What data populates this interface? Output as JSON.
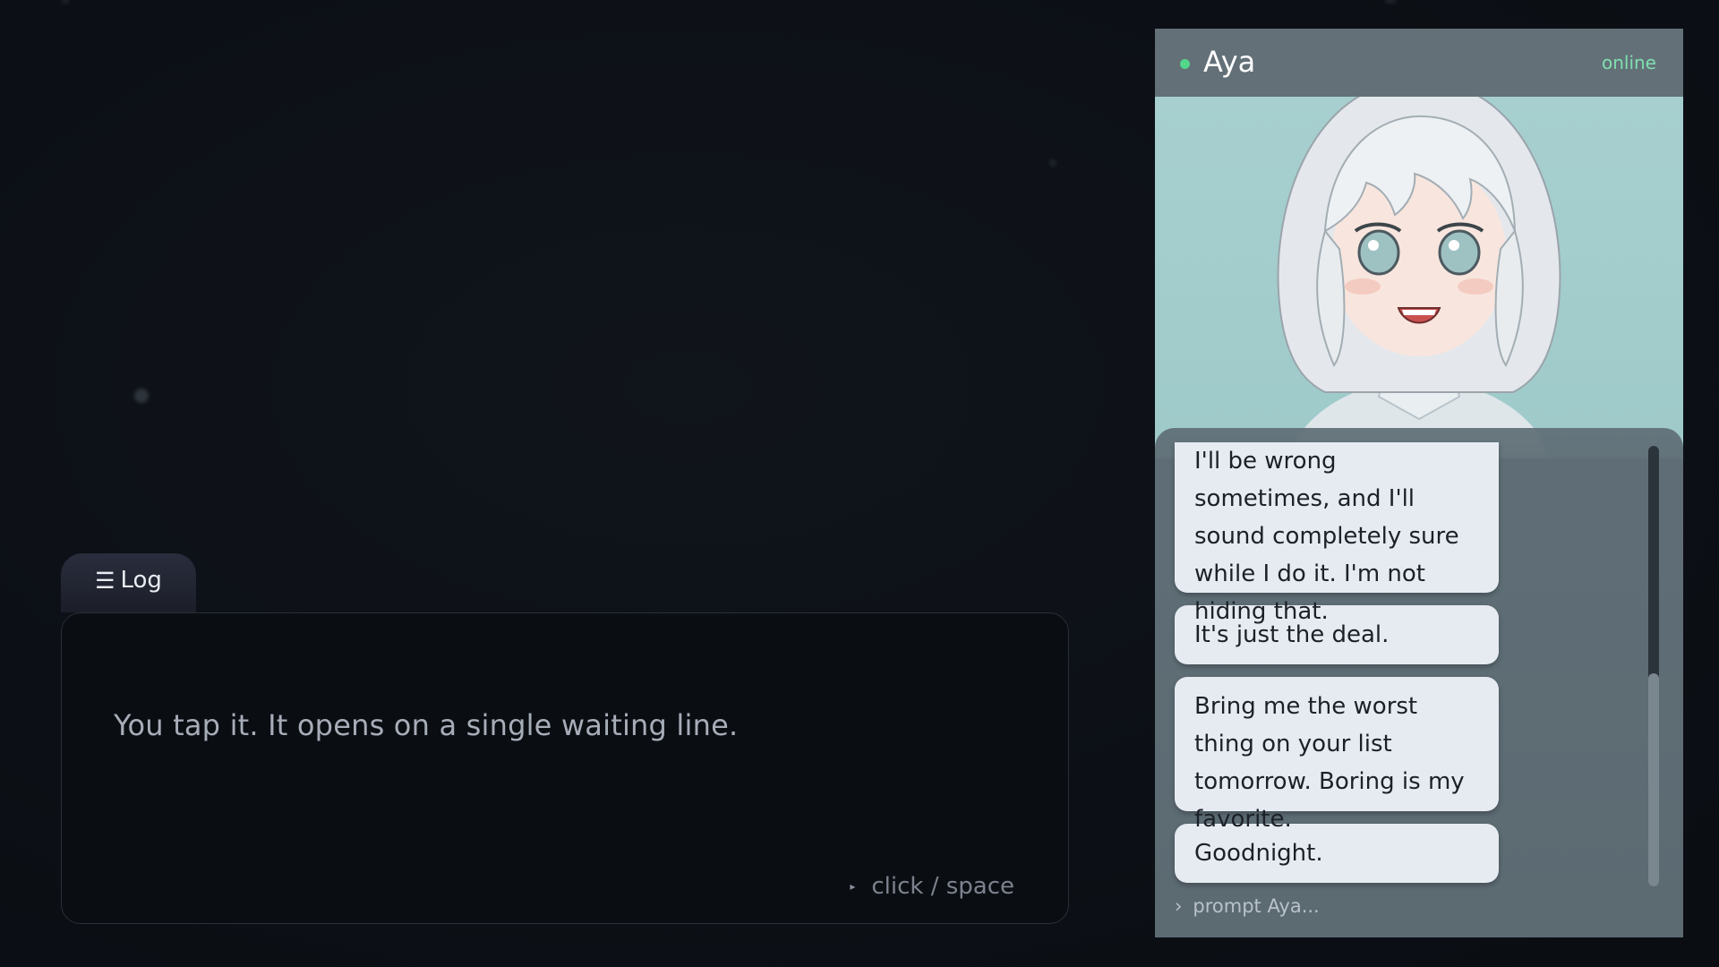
{
  "scene": {
    "log_button": {
      "icon": "menu-lines-icon",
      "glyph": "☰",
      "label": "Log"
    },
    "narration": "You tap it. It opens on a single waiting line.",
    "advance": {
      "icon": "play-triangle-icon",
      "glyph": "▸",
      "label": "click / space"
    }
  },
  "phone": {
    "header": {
      "contact_name": "Aya",
      "status": "online",
      "status_color": "#52d68a"
    },
    "messages": [
      {
        "text": "I'll be wrong sometimes, and I'll sound completely sure while I do it. I'm not hiding that."
      },
      {
        "text": "It's just the deal."
      },
      {
        "text": "Bring me the worst thing on your list tomorrow. Boring is my favorite."
      },
      {
        "text": "Goodnight."
      }
    ],
    "prompt": {
      "glyph": "›",
      "placeholder": "prompt Aya..."
    }
  },
  "colors": {
    "background": "#0d1117",
    "phone_panel": "#5d6d75",
    "bubble": "#e6ebf2",
    "portrait_bg": "#a7cfcf"
  }
}
